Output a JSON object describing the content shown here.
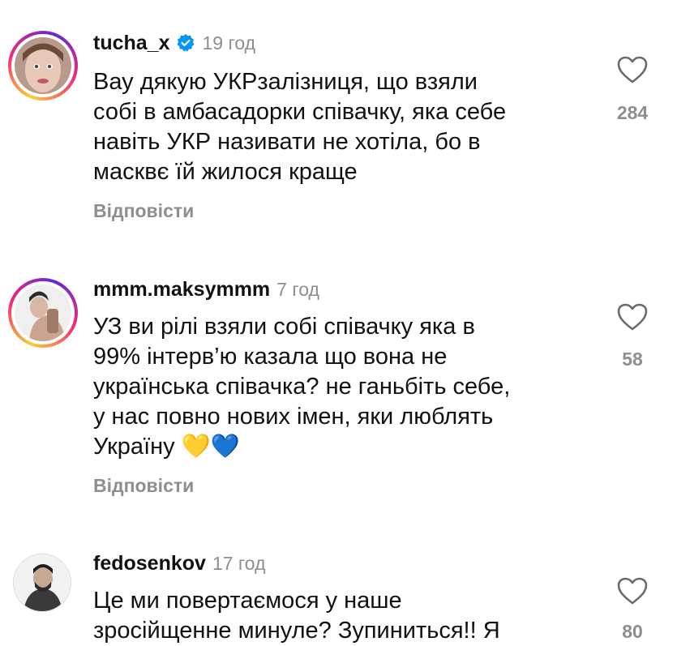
{
  "comments": [
    {
      "username": "tucha_x",
      "verified": true,
      "time": "19 год",
      "text": "Вау дякую УКРзалізниця, що взяли\nсобі в амбасадорки співачку, яка себе\nнавіть УКР називати не хотіла, бо в\nмасквє їй жилося краще",
      "reply": "Відповісти",
      "likes": "284",
      "has_story": true
    },
    {
      "username": "mmm.maksymmm",
      "verified": false,
      "time": "7 год",
      "text": "УЗ ви рілі взяли собі співачку яка в\n99% інтерв’ю казала що вона не\nукраїнська співачка? не ганьбіть себе,\nу нас повно нових імен, яки люблять\nУкраїну 💛💙",
      "reply": "Відповісти",
      "likes": "58",
      "has_story": true
    },
    {
      "username": "fedosenkov",
      "verified": false,
      "time": "17 год",
      "text": "Це ми повертаємося у наше\nзросійщенне минуле? Зупиниться!! Я",
      "reply": "",
      "likes": "80",
      "has_story": false
    }
  ],
  "colors": {
    "verified_badge": "#0095f6",
    "secondary_text": "#8e8e8e",
    "primary_text": "#111111"
  },
  "icons": {
    "like": "heart-outline-icon",
    "verified": "verified-badge-icon"
  }
}
